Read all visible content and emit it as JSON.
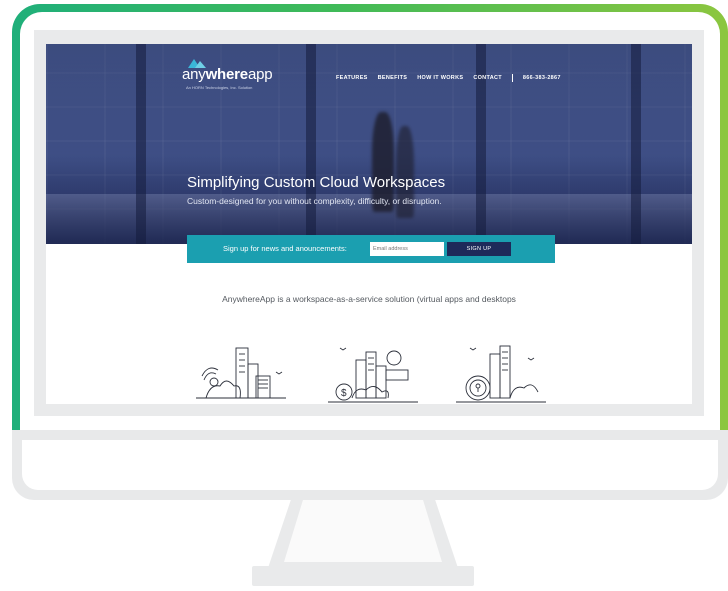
{
  "site": {
    "logo": {
      "text_light": "any",
      "text_bold": "where",
      "text_end": "app",
      "subtitle": "An HORN Technologies, Inc. Solution"
    },
    "nav": {
      "items": [
        "FEATURES",
        "BENEFITS",
        "HOW IT WORKS",
        "CONTACT"
      ],
      "phone": "866-383-2867"
    },
    "hero": {
      "title": "Simplifying Custom  Cloud Workspaces",
      "subtitle": "Custom-designed for you without complexity, difficulty, or disruption."
    },
    "signup": {
      "label": "Sign up for news and anouncements:",
      "placeholder": "Email address",
      "button": "SIGN UP"
    },
    "tagline": "AnywhereApp is a workspace-as-a-service solution (virtual apps and desktops",
    "illustrations": [
      "satellite-city-icon",
      "dollar-city-icon",
      "lock-city-icon"
    ]
  },
  "colors": {
    "bezel_start": "#1faf7a",
    "bezel_end": "#8cc63f",
    "signup_bar": "#1b9fb0",
    "signup_button": "#1e2a5a",
    "hero_tint": "#46578f"
  }
}
